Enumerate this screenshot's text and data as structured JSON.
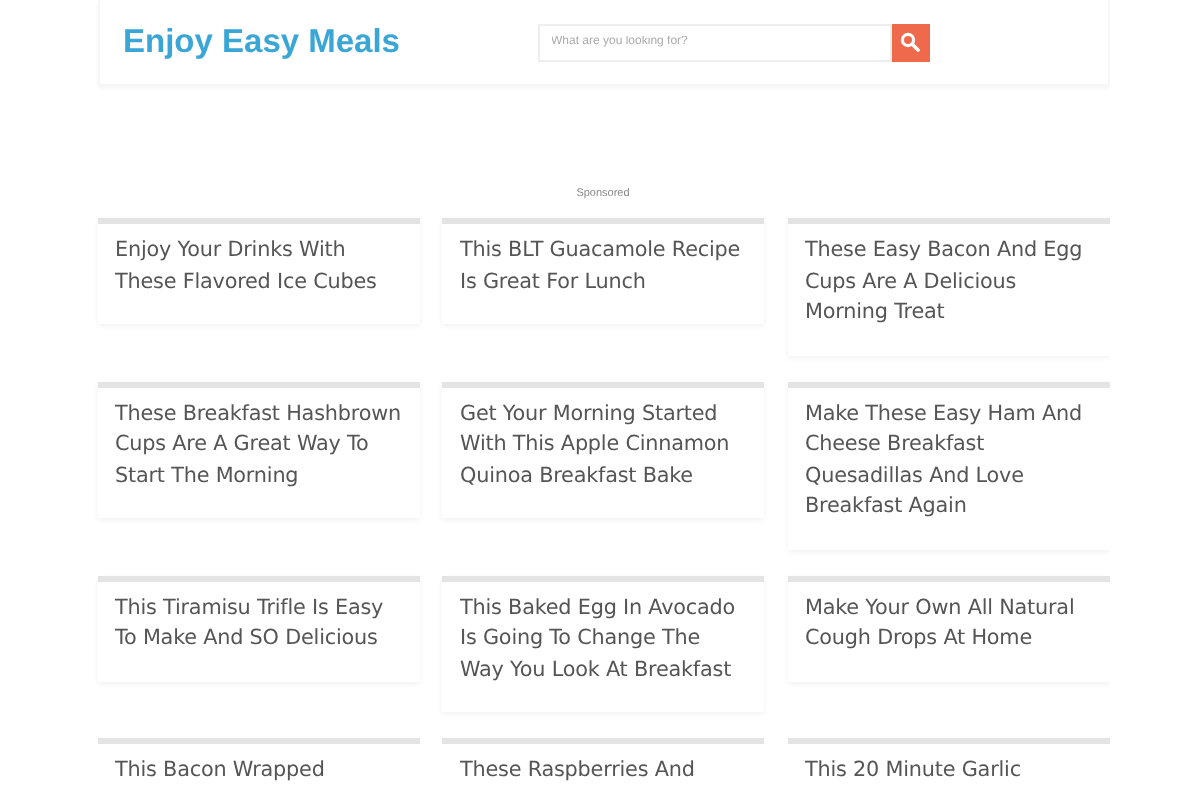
{
  "header": {
    "logo": "Enjoy Easy Meals",
    "search": {
      "placeholder": "What are you looking for?"
    }
  },
  "sponsored": "Sponsored",
  "articles": [
    {
      "title": "Enjoy Your Drinks With These Flavored Ice Cubes"
    },
    {
      "title": "This BLT Guacamole Recipe Is Great For Lunch"
    },
    {
      "title": "These Easy Bacon And Egg Cups Are A Delicious Morning Treat"
    },
    {
      "title": "These Breakfast Hashbrown Cups Are A Great Way To Start The Morning"
    },
    {
      "title": "Get Your Morning Started With This Apple Cinnamon Quinoa Breakfast Bake"
    },
    {
      "title": "Make These Easy Ham And Cheese Breakfast Quesadillas And Love Breakfast Again"
    },
    {
      "title": "This Tiramisu Trifle Is Easy To Make And SO Delicious"
    },
    {
      "title": "This Baked Egg In Avocado Is Going To Change The Way You Look At Breakfast"
    },
    {
      "title": "Make Your Own All Natural Cough Drops At Home"
    },
    {
      "title": "This Bacon Wrapped"
    },
    {
      "title": "These Raspberries And"
    },
    {
      "title": "This 20 Minute Garlic"
    }
  ]
}
